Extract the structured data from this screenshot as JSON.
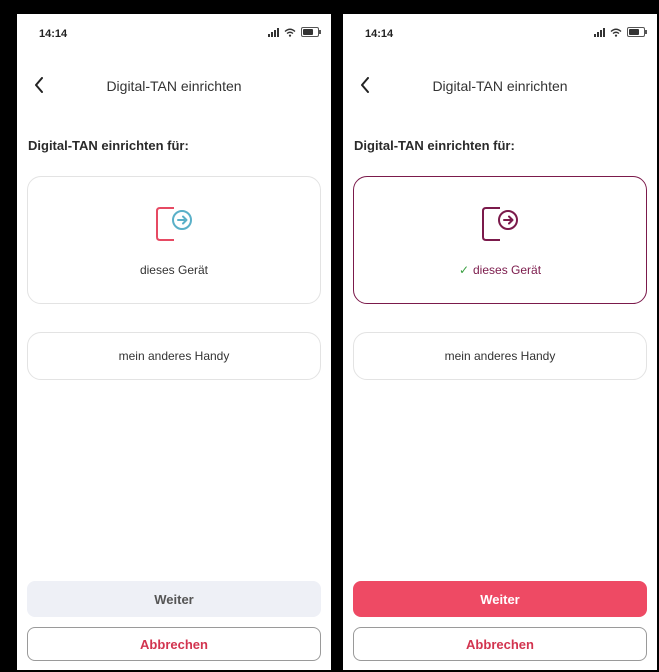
{
  "colors": {
    "accent_red": "#ee4a64",
    "selected_border": "#7b1a4b",
    "icon_blue": "#5ab0c8",
    "check_green": "#3aa041",
    "disabled_button": "#eef0f6"
  },
  "screens": [
    {
      "status": {
        "time": "14:14",
        "icons": [
          "signal-icon",
          "wifi-icon",
          "battery-icon"
        ]
      },
      "nav": {
        "back_icon": "chevron-left-icon",
        "title": "Digital-TAN einrichten"
      },
      "heading": "Digital-TAN einrichten für:",
      "options": [
        {
          "label": "dieses Gerät",
          "icon": "phone-arrow-icon",
          "selected": false
        },
        {
          "label": "mein anderes Handy",
          "selected": false
        }
      ],
      "primary_button": {
        "label": "Weiter",
        "state": "disabled"
      },
      "secondary_button": {
        "label": "Abbrechen"
      }
    },
    {
      "status": {
        "time": "14:14",
        "icons": [
          "signal-icon",
          "wifi-icon",
          "battery-icon"
        ]
      },
      "nav": {
        "back_icon": "chevron-left-icon",
        "title": "Digital-TAN einrichten"
      },
      "heading": "Digital-TAN einrichten für:",
      "options": [
        {
          "label": "dieses Gerät",
          "icon": "phone-arrow-icon",
          "selected": true,
          "check_icon": "check-icon"
        },
        {
          "label": "mein anderes Handy",
          "selected": false
        }
      ],
      "primary_button": {
        "label": "Weiter",
        "state": "active"
      },
      "secondary_button": {
        "label": "Abbrechen"
      }
    }
  ]
}
